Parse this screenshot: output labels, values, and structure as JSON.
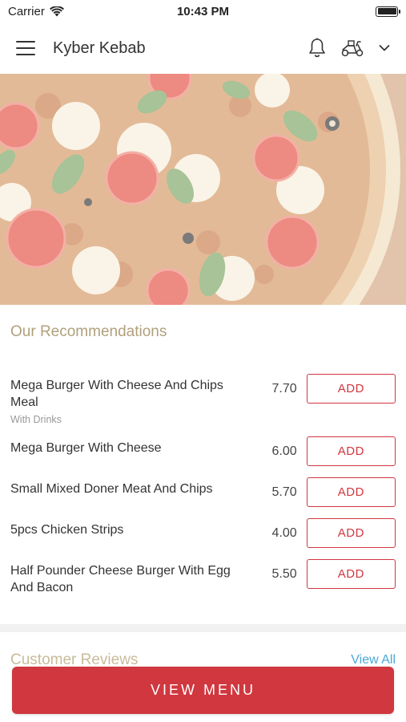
{
  "status_bar": {
    "carrier": "Carrier",
    "time": "10:43 PM"
  },
  "header": {
    "title": "Kyber Kebab",
    "icons": [
      "menu-icon",
      "bell-icon",
      "scooter-icon",
      "chevron-down-icon"
    ]
  },
  "hero": {
    "image": "pizza-photo"
  },
  "recommendations": {
    "title": "Our Recommendations",
    "items": [
      {
        "name": "Mega Burger With Cheese And Chips Meal",
        "subtitle": "With Drinks",
        "price": "7.70",
        "action": "ADD"
      },
      {
        "name": "Mega Burger With Cheese",
        "subtitle": "",
        "price": "6.00",
        "action": "ADD"
      },
      {
        "name": "Small Mixed Doner Meat And Chips",
        "subtitle": "",
        "price": "5.70",
        "action": "ADD"
      },
      {
        "name": "5pcs Chicken Strips",
        "subtitle": "",
        "price": "4.00",
        "action": "ADD"
      },
      {
        "name": "Half Pounder Cheese Burger With Egg And Bacon",
        "subtitle": "",
        "price": "5.50",
        "action": "ADD"
      }
    ]
  },
  "reviews": {
    "title": "Customer Reviews",
    "view_all": "View All"
  },
  "footer": {
    "button_label": "VIEW MENU"
  },
  "colors": {
    "accent": "#d0373f",
    "section_title": "#b0a07c",
    "link": "#4aa8d6"
  }
}
